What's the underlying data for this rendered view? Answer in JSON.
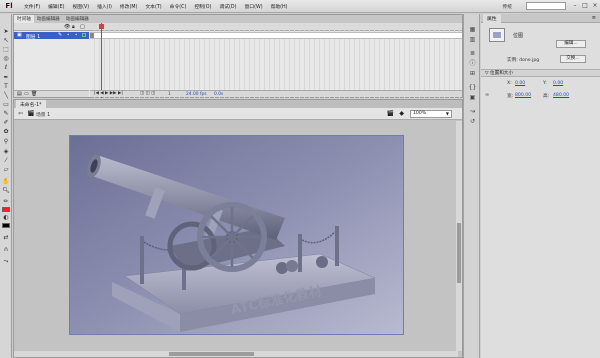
{
  "app": {
    "logo": "Fl",
    "menus": [
      "文件(F)",
      "编辑(E)",
      "视图(V)",
      "插入(I)",
      "修改(M)",
      "文本(T)",
      "命令(C)",
      "控制(O)",
      "调试(D)",
      "窗口(W)",
      "帮助(H)"
    ],
    "workspace": "传统",
    "window_controls": [
      "–",
      "□",
      "×"
    ]
  },
  "timeline": {
    "tabs": [
      "时间轴",
      "动画编辑器",
      "动画编辑器"
    ],
    "layer_name": "图层 1",
    "footer_fps": "24.00 fps",
    "footer_time": "0.0s",
    "footer_frame": "1"
  },
  "document": {
    "tab_label": "未命名-1*",
    "scene_label": "场景 1",
    "zoom": "100%"
  },
  "stage_image": {
    "engraving": "ATC标准化教材"
  },
  "properties": {
    "tab_label": "属性",
    "type_label": "位图",
    "edit_button": "编辑...",
    "instance_text": "实例: done.jpg",
    "swap_button": "交换...",
    "section_title": "位置和大小",
    "x_label": "X:",
    "x_value": "0.00",
    "y_label": "Y:",
    "y_value": "0.00",
    "w_label": "宽:",
    "w_value": "800.00",
    "h_label": "高:",
    "h_value": "480.00"
  },
  "colors": {
    "accent_layer": "#3860c8",
    "playhead": "#e0302a",
    "link_value": "#2a4fb5"
  }
}
